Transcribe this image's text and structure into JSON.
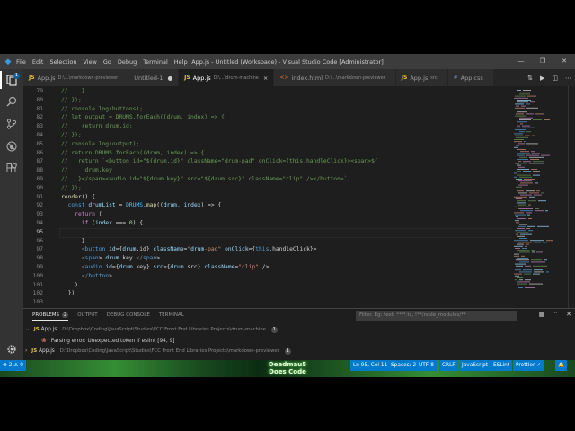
{
  "window": {
    "title": "App.js - Untitled (Workspace) - Visual Studio Code [Administrator]",
    "menu": [
      "File",
      "Edit",
      "Selection",
      "View",
      "Go",
      "Debug",
      "Terminal",
      "Help"
    ]
  },
  "activity_bar": {
    "explorer_badge": "1"
  },
  "tabs": [
    {
      "name": "App.js",
      "desc": "D:\\...\\markdown-previewer",
      "kind": "js",
      "active": false,
      "modified": false
    },
    {
      "name": "Untitled-1",
      "desc": "",
      "kind": "txt",
      "active": false,
      "modified": true
    },
    {
      "name": "App.js",
      "desc": "D:\\...\\drum-machine",
      "kind": "js",
      "active": true,
      "modified": false
    },
    {
      "name": "index.html",
      "desc": "D:\\...\\markdown-previewer",
      "kind": "html",
      "active": false,
      "modified": false
    },
    {
      "name": "App.js",
      "desc": "src",
      "kind": "js",
      "active": false,
      "modified": false
    },
    {
      "name": "App.css",
      "desc": "",
      "kind": "css",
      "active": false,
      "modified": false
    }
  ],
  "editor": {
    "current_line": 95,
    "lines": [
      {
        "n": "79",
        "code": "//    }"
      },
      {
        "n": "80",
        "code": "// });"
      },
      {
        "n": "81",
        "code": "// console.log(buttons);"
      },
      {
        "n": "82",
        "code": "// let output = DRUMS.forEach((drum, index) => {"
      },
      {
        "n": "83",
        "code": "//    return drum.id;"
      },
      {
        "n": "84",
        "code": "// });"
      },
      {
        "n": "85",
        "code": "// console.log(output);"
      },
      {
        "n": "86",
        "code": "// return DRUMS.forEach((drum, index) => {"
      },
      {
        "n": "87",
        "code": "//   return `<button id=\"${drum.id}\" className=\"drum-pad\" onClick={this.handleClick}><span>${"
      },
      {
        "n": "88",
        "code": "//     drum.key"
      },
      {
        "n": "89",
        "code": "//   }</span><audio id=\"${drum.key}\" src=\"${drum.src}\" className=\"clip\" /></button>`;"
      },
      {
        "n": "90",
        "code": "// });"
      },
      {
        "n": "91",
        "code": "render() {"
      },
      {
        "n": "92",
        "code": "  const drumList = DRUMS.map((drum, index) => {"
      },
      {
        "n": "93",
        "code": "    return ("
      },
      {
        "n": "94",
        "code": "      if (index === 0) {"
      },
      {
        "n": "95",
        "code": ""
      },
      {
        "n": "96",
        "code": "      }"
      },
      {
        "n": "97",
        "code": "      <button id={drum.id} className=\"drum-pad\" onClick={this.handleClick}>"
      },
      {
        "n": "98",
        "code": "      <span> drum.key </span>"
      },
      {
        "n": "99",
        "code": "      <audio id={drum.key} src={drum.src} className=\"clip\" />"
      },
      {
        "n": "100",
        "code": "      </button>"
      },
      {
        "n": "101",
        "code": "    )"
      },
      {
        "n": "102",
        "code": "  })"
      },
      {
        "n": "103",
        "code": ""
      }
    ]
  },
  "panel": {
    "tabs": [
      {
        "label": "Problems",
        "badge": "2",
        "active": true
      },
      {
        "label": "Output",
        "badge": "",
        "active": false
      },
      {
        "label": "Debug Console",
        "badge": "",
        "active": false
      },
      {
        "label": "Terminal",
        "badge": "",
        "active": false
      }
    ],
    "filter_placeholder": "Filter. Eg: text, **/*.ts, !**/node_modules/**",
    "problems": [
      {
        "file": "App.js",
        "path": "D:\\Dropbox\\Coding\\JavaScript\\Studies\\FCC Front End Libraries Projects\\drum-machine",
        "count": "1",
        "message": "Parsing error: Unexpected token if  eslint  [94, 9]"
      },
      {
        "file": "App.js",
        "path": "D:\\Dropbox\\Coding\\JavaScript\\Studies\\FCC Front End Libraries Projects\\markdown-previewer",
        "count": "1"
      }
    ]
  },
  "statusbar": {
    "left": "⊗ 2  ⚠ 0",
    "position": "Ln 95, Col 11",
    "spaces": "Spaces: 2",
    "encoding": "UTF-8",
    "eol": "CRLF",
    "language": "JavaScript",
    "linter": "ESLint",
    "prettier": "Prettier ✓",
    "theme_text": "Deadmau5 Does Code"
  },
  "colors": {
    "accent": "#007acc",
    "titlebar": "#3c3c3c",
    "editor_bg": "#1e1e1e"
  }
}
